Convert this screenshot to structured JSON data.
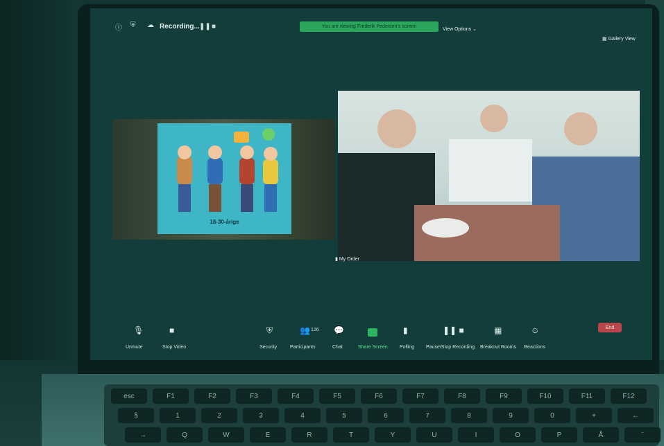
{
  "top_bar": {
    "recording_label": "Recording...",
    "banner": "You are viewing Frederik Pedersen's screen",
    "view_options": "View Options",
    "gallery_view": "Gallery View"
  },
  "shared_screen": {
    "slide_caption": "18-30-årige"
  },
  "video": {
    "name_label": "My Order"
  },
  "toolbar": {
    "unmute": "Unmute",
    "stop_video": "Stop Video",
    "security": "Security",
    "participants": "Participants",
    "participant_count": "126",
    "chat": "Chat",
    "share_screen": "Share Screen",
    "polling": "Polling",
    "pause_stop_recording": "Pause/Stop Recording",
    "breakout_rooms": "Breakout Rooms",
    "reactions": "Reactions",
    "end": "End"
  },
  "keyboard": {
    "rows": [
      [
        "esc",
        "F1",
        "F2",
        "F3",
        "F4",
        "F5",
        "F6",
        "F7",
        "F8",
        "F9",
        "F10",
        "F11",
        "F12"
      ],
      [
        "§",
        "1",
        "2",
        "3",
        "4",
        "5",
        "6",
        "7",
        "8",
        "9",
        "0",
        "+",
        "←"
      ],
      [
        "→",
        "Q",
        "W",
        "E",
        "R",
        "T",
        "Y",
        "U",
        "I",
        "O",
        "P",
        "Å",
        "¨"
      ]
    ]
  },
  "colors": {
    "overlay_teal": "#123d3a",
    "banner_green": "#2aa65d",
    "end_red": "#b8474c"
  }
}
